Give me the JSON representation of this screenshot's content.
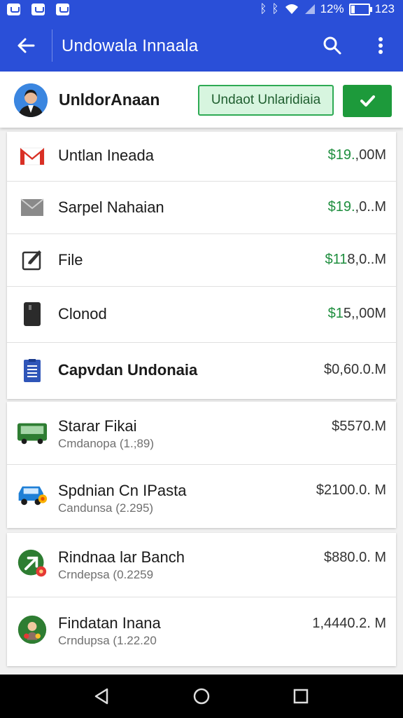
{
  "status_bar": {
    "signal_percent": "12%",
    "time": "123"
  },
  "app_bar": {
    "title": "Undowala Innaala"
  },
  "profile": {
    "name": "UnldorAnaan",
    "pending_label": "Undaot Unlaridiaia"
  },
  "accounts": [
    {
      "label": "Untlan Ineada",
      "amount_green": "$19.",
      "amount_rest": ",00M",
      "icon": "gmail-icon"
    },
    {
      "label": "Sarpel Nahaian",
      "amount_green": "$19.",
      "amount_rest": ",0..M",
      "icon": "mail-icon"
    },
    {
      "label": "File",
      "amount_green": "$11",
      "amount_rest": "8,0..M",
      "icon": "edit-icon"
    },
    {
      "label": "Clonod",
      "amount_green": "$1",
      "amount_rest": "5,,00M",
      "icon": "phone-icon"
    },
    {
      "label": "Capvdan Undonaia",
      "amount_green": "",
      "amount_rest": "$0,60.0.M",
      "icon": "document-icon"
    }
  ],
  "transport": [
    {
      "label": "Starar Fikai",
      "sub": "Cmdanopa (1.;89)",
      "amount": "$5570.M",
      "icon": "bus-icon"
    },
    {
      "label": "Spdnian Cn IPasta",
      "sub": "Candunsa (2.295)",
      "amount": "$2100.0. M",
      "icon": "car-icon"
    }
  ],
  "contacts": [
    {
      "label": "Rindnaa lar Banch",
      "sub": "Crndepsa (0.2259",
      "amount": "$880.0. M",
      "icon": "arrow-badge-icon"
    },
    {
      "label": "Findatan Inana",
      "sub": "Crndupsa (1.22.20",
      "amount": "1,4440.2. M",
      "icon": "food-avatar-icon"
    }
  ],
  "colors": {
    "primary": "#2a4fd8",
    "accent_green": "#1d9a3b"
  }
}
